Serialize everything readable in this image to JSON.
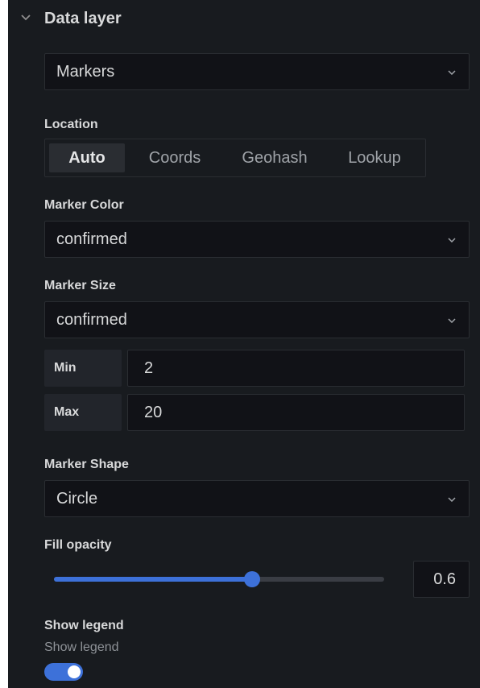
{
  "section": {
    "title": "Data layer",
    "collapse_icon": "chevron-down-icon"
  },
  "layer_type": {
    "value": "Markers",
    "icon": "chevron-down-icon"
  },
  "location": {
    "label": "Location",
    "options": [
      "Auto",
      "Coords",
      "Geohash",
      "Lookup"
    ],
    "selected": "Auto"
  },
  "marker_color": {
    "label": "Marker Color",
    "value": "confirmed"
  },
  "marker_size": {
    "label": "Marker Size",
    "value": "confirmed",
    "min_label": "Min",
    "min_value": "2",
    "max_label": "Max",
    "max_value": "20"
  },
  "marker_shape": {
    "label": "Marker Shape",
    "value": "Circle"
  },
  "fill_opacity": {
    "label": "Fill opacity",
    "value": "0.6",
    "level": 0.6
  },
  "show_legend": {
    "label": "Show legend",
    "description": "Show legend",
    "enabled": true
  },
  "colors": {
    "panel_bg": "#181b1f",
    "input_bg": "#111217",
    "accent": "#3d71d9",
    "text": "#d8d9da",
    "muted": "#8e9297"
  }
}
